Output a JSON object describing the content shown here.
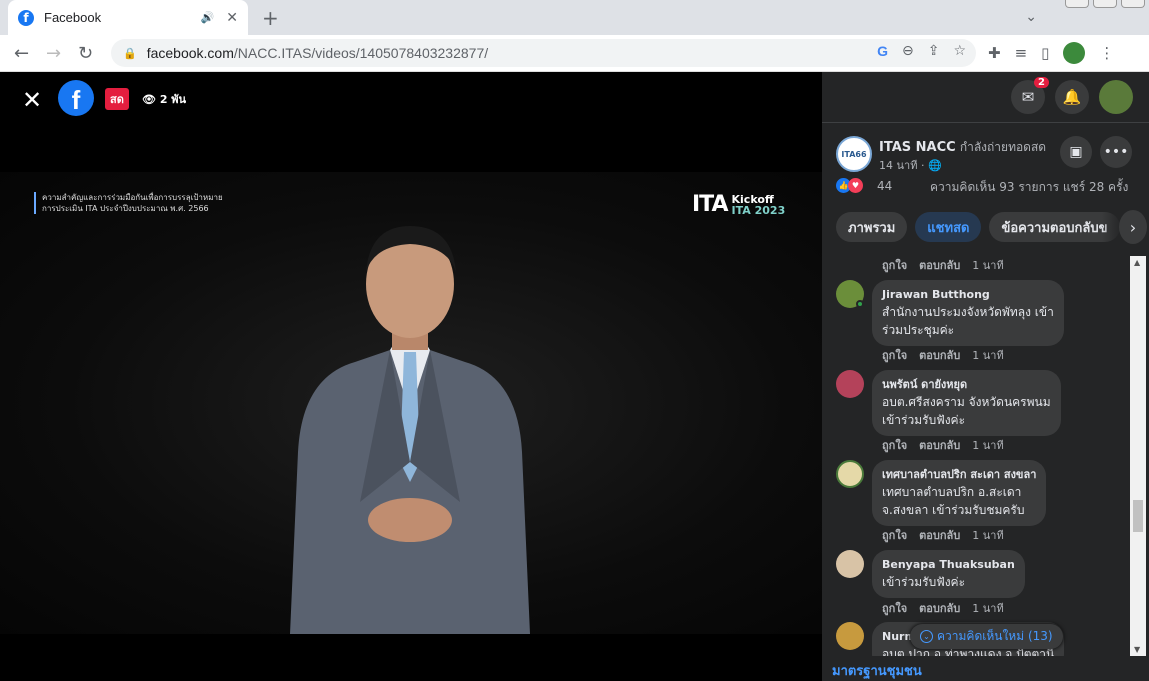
{
  "browser": {
    "tab_title": "Facebook",
    "url_host": "facebook.com",
    "url_path": "/NACC.ITAS/videos/1405078403232877/"
  },
  "video": {
    "live_label": "สด",
    "viewers": "2 พัน",
    "caption_line1": "ความสำคัญและการร่วมมือกันเพื่อการบรรลุเป้าหมาย",
    "caption_line2": "การประเมิน ITA ประจำปีงบประมาณ พ.ศ. 2566",
    "brand_big": "ITA",
    "brand_kickoff": "Kickoff",
    "brand_ita": "ITA",
    "brand_year": "2023"
  },
  "sidebar": {
    "messenger_badge": "2",
    "page_avatar_text": "ITA66",
    "page_name": "ITAS NACC",
    "page_status": "กำลังถ่ายทอดสด",
    "page_time": "14 นาที ·",
    "reaction_count": "44",
    "comments_shares": "ความคิดเห็น 93 รายการ  แชร์ 28 ครั้ง",
    "tabs": [
      {
        "label": "ภาพรวม"
      },
      {
        "label": "แชทสด"
      },
      {
        "label": "ข้อความตอบกลับข"
      }
    ],
    "action_like": "ถูกใจ",
    "action_reply": "ตอบกลับ",
    "time_ago": "1 นาที",
    "comments": [
      {
        "name": "Jirawan Butthong",
        "lines": [
          "สำนักงานประมงจังหวัดพัทลุง เข้า",
          "ร่วมประชุมค่ะ"
        ],
        "avatar_color": "#6b8e3a"
      },
      {
        "name": "นพรัตน์ ดายังหยุด",
        "lines": [
          "อบต.ศรีสงคราม จังหวัดนครพนม",
          "เข้าร่วมรับฟังค่ะ"
        ],
        "avatar_color": "#b4425a"
      },
      {
        "name": "เทศบาลตำบลปริก สะเดา สงขลา",
        "lines": [
          "เทศบาลตำบลปริก อ.สะเดา",
          "จ.สงขลา เข้าร่วมรับชมครับ"
        ],
        "avatar_color": "#e5d9a8"
      },
      {
        "name": "Benyapa Thuaksuban",
        "lines": [
          "เข้าร่วมรับฟังค่ะ"
        ],
        "avatar_color": "#d8c3a6"
      },
      {
        "name": "Nurm",
        "lines": [
          "อบต.ปาก อ.ท่าพางแดง จ.ปัตตานี"
        ],
        "avatar_color": "#c79a3e"
      }
    ],
    "new_comments": "ความคิดเห็นใหม่ (13)",
    "community_standards": "มาตรฐานชุมชน"
  }
}
